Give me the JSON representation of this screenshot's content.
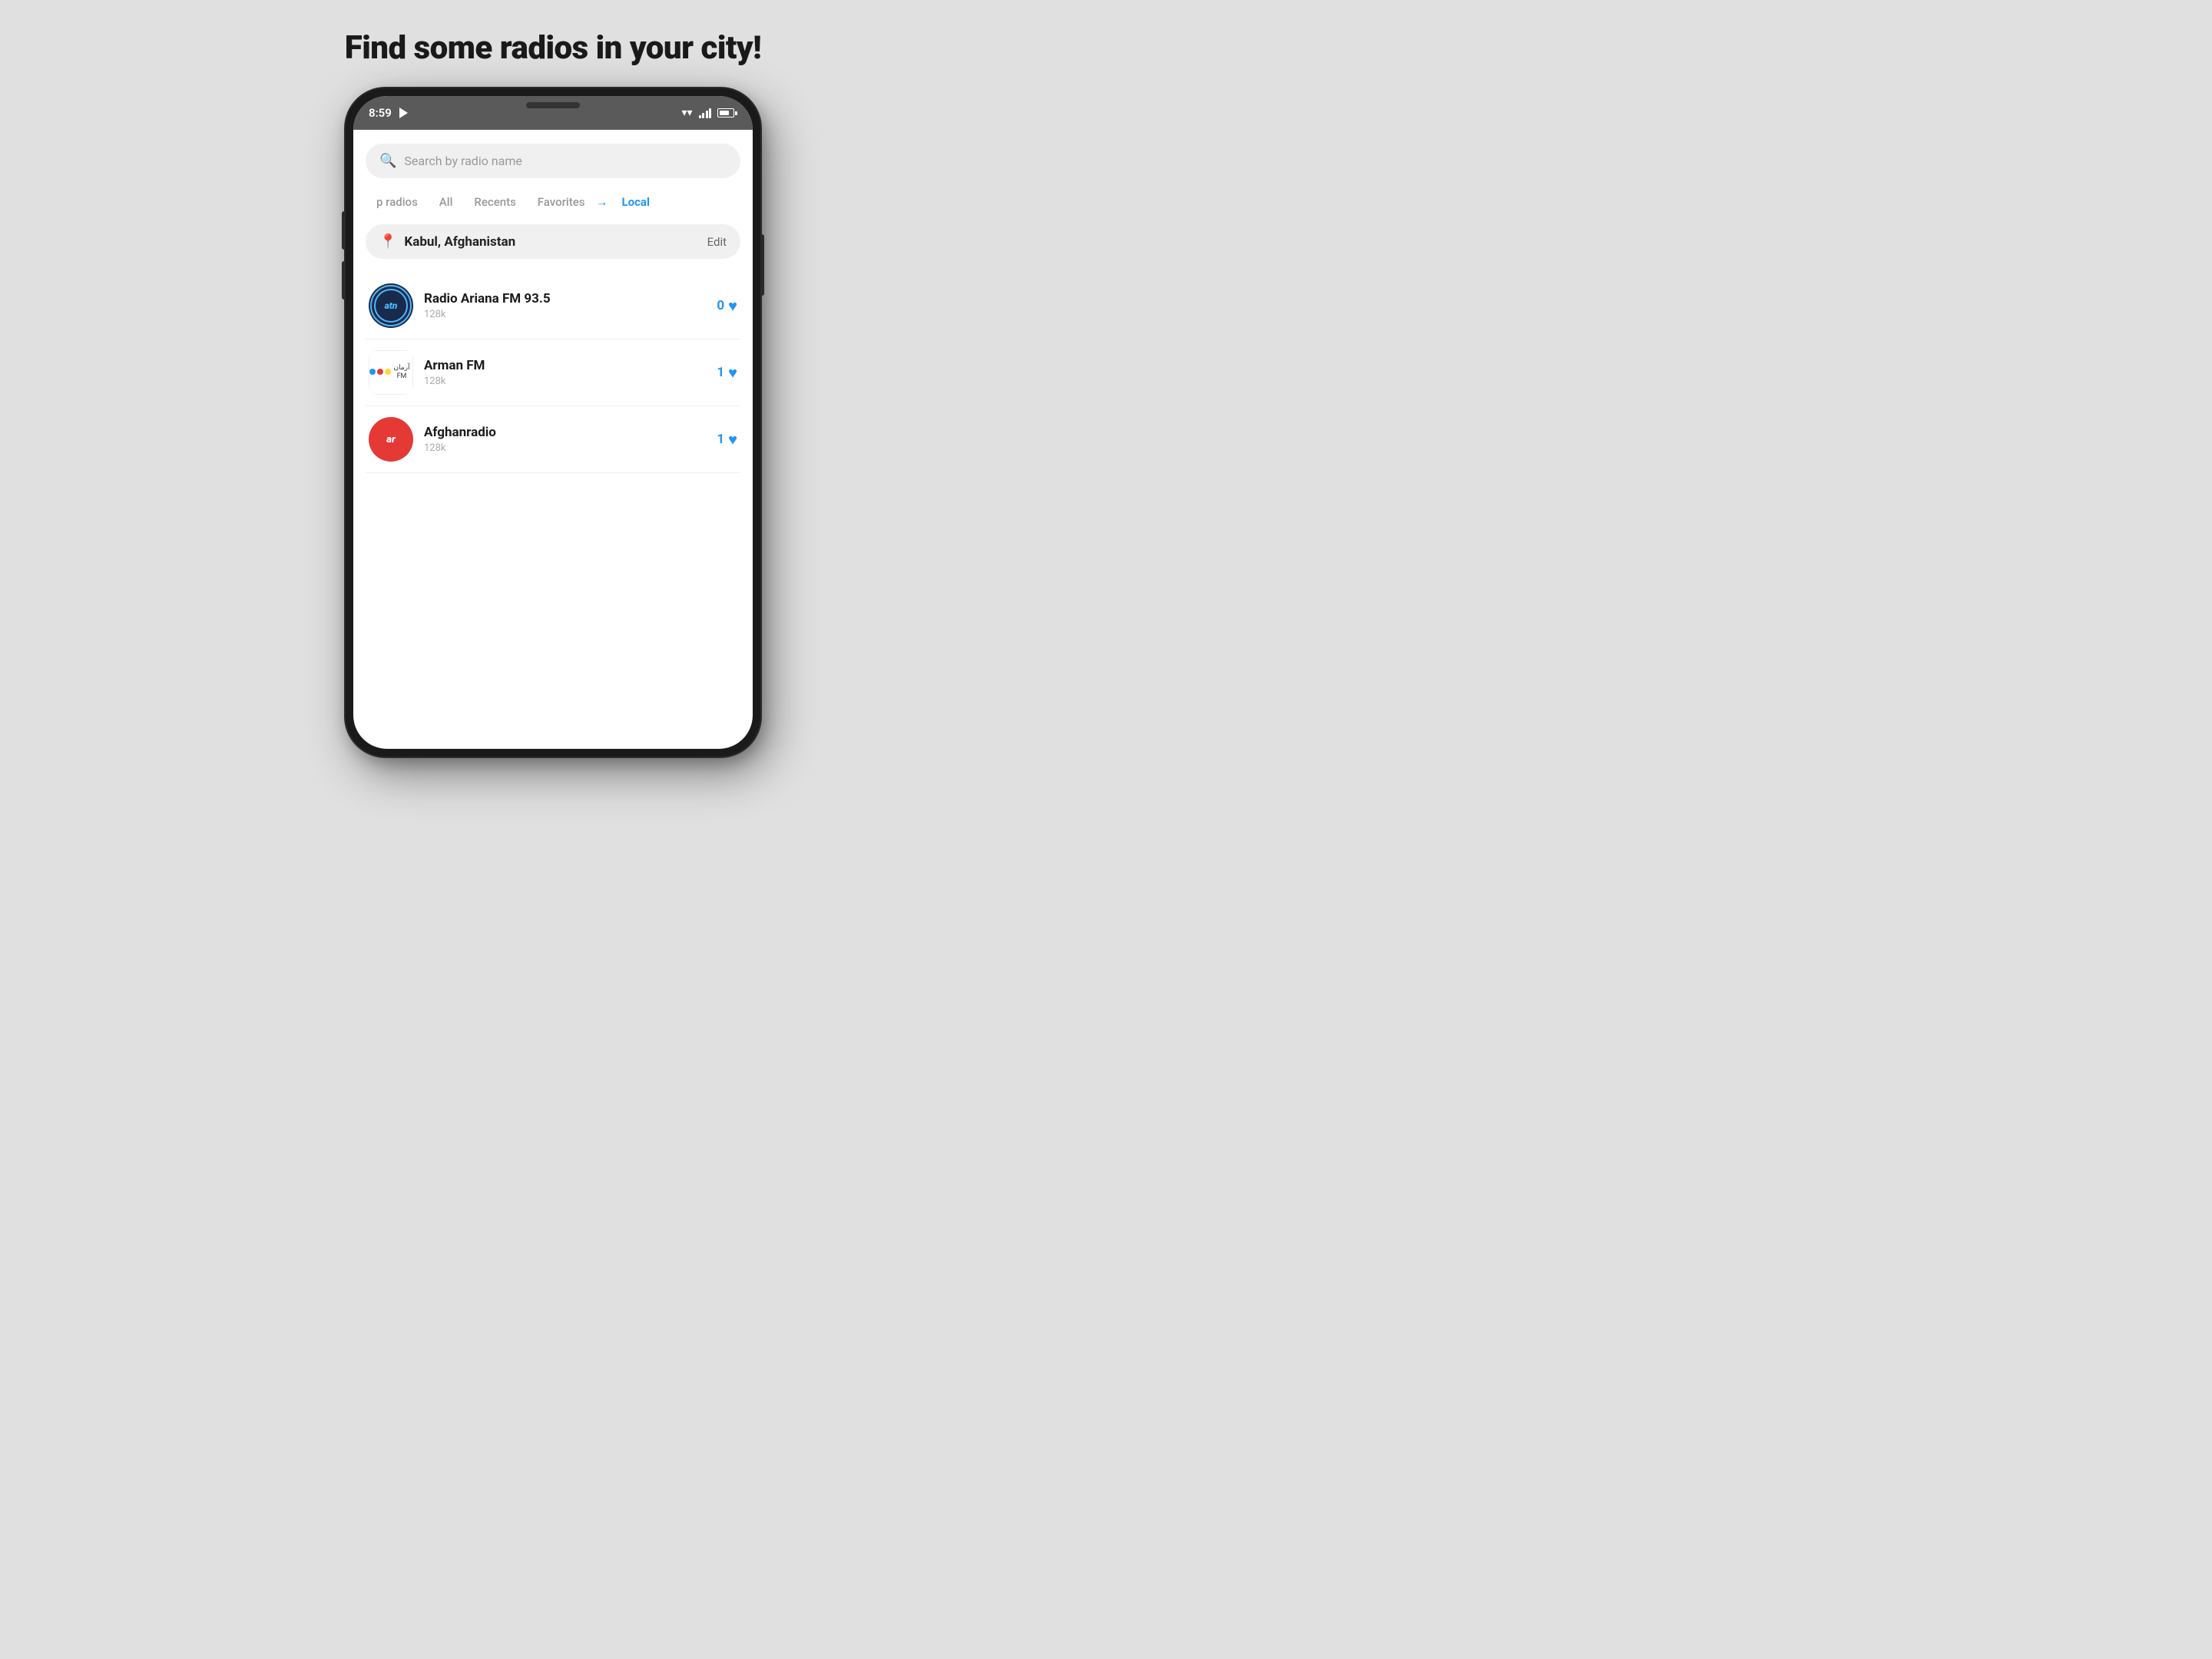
{
  "page": {
    "title": "Find some radios in your city!",
    "background_color": "#e0e0e0"
  },
  "status_bar": {
    "time": "8:59",
    "signal_full": true
  },
  "search": {
    "placeholder": "Search by radio name"
  },
  "tabs": [
    {
      "label": "p radios",
      "active": false
    },
    {
      "label": "All",
      "active": false
    },
    {
      "label": "Recents",
      "active": false
    },
    {
      "label": "Favorites",
      "active": false
    },
    {
      "label": "Local",
      "active": true
    }
  ],
  "location": {
    "name": "Kabul, Afghanistan",
    "edit_label": "Edit"
  },
  "radios": [
    {
      "name": "Radio Ariana FM 93.5",
      "bitrate": "128k",
      "favorites": "0",
      "logo_type": "ariana"
    },
    {
      "name": "Arman FM",
      "bitrate": "128k",
      "favorites": "1",
      "logo_type": "arman"
    },
    {
      "name": "Afghanradio",
      "bitrate": "128k",
      "favorites": "1",
      "logo_type": "afghan"
    }
  ]
}
